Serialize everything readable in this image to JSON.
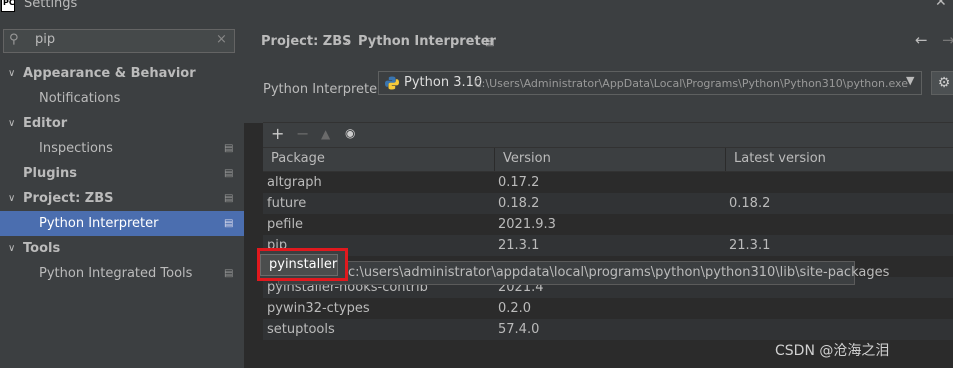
{
  "window": {
    "title": "Settings",
    "app_icon_text": "PC",
    "close": "✕"
  },
  "search": {
    "value": "pip",
    "clear": "×"
  },
  "sidebar": {
    "items": [
      {
        "label": "Appearance & Behavior",
        "arrow": "∨"
      },
      {
        "label": "Notifications"
      },
      {
        "label": "Editor",
        "arrow": "∨"
      },
      {
        "label": "Inspections"
      },
      {
        "label": "Plugins"
      },
      {
        "label": "Project: ZBS",
        "arrow": "∨"
      },
      {
        "label": "Python Interpreter"
      },
      {
        "label": "Tools",
        "arrow": "∨"
      },
      {
        "label": "Python Integrated Tools"
      }
    ]
  },
  "breadcrumb": {
    "project": "Project: ZBS",
    "sep": "›",
    "page": "Python Interpreter",
    "back": "←",
    "forward": "→"
  },
  "interpreter": {
    "label": "Python Interpreter:",
    "version": "Python 3.10",
    "path": "C:\\Users\\Administrator\\AppData\\Local\\Programs\\Python\\Python310\\python.exe"
  },
  "toolbar": {
    "add": "+",
    "remove": "−",
    "upgrade": "▲",
    "show": "👁"
  },
  "table": {
    "headers": [
      "Package",
      "Version",
      "Latest version"
    ],
    "rows": [
      {
        "package": "altgraph",
        "version": "0.17.2",
        "latest": ""
      },
      {
        "package": "future",
        "version": "0.18.2",
        "latest": "0.18.2"
      },
      {
        "package": "pefile",
        "version": "2021.9.3",
        "latest": ""
      },
      {
        "package": "pip",
        "version": "21.3.1",
        "latest": "21.3.1"
      },
      {
        "package": "pyinstaller",
        "version": "",
        "latest": ""
      },
      {
        "package": "pyinstaller-hooks-contrib",
        "version": "2021.4",
        "latest": ""
      },
      {
        "package": "pywin32-ctypes",
        "version": "0.2.0",
        "latest": ""
      },
      {
        "package": "setuptools",
        "version": "57.4.0",
        "latest": ""
      }
    ]
  },
  "tooltip": {
    "name": "pyinstaller",
    "location": "c:\\users\\administrator\\appdata\\local\\programs\\python\\python310\\lib\\site-packages"
  },
  "watermark": "CSDN @沧海之泪",
  "colors": {
    "selection": "#4b6eaf",
    "highlight_box": "#e0191e",
    "background": "#2b2b2b",
    "panel": "#3c3f41"
  }
}
